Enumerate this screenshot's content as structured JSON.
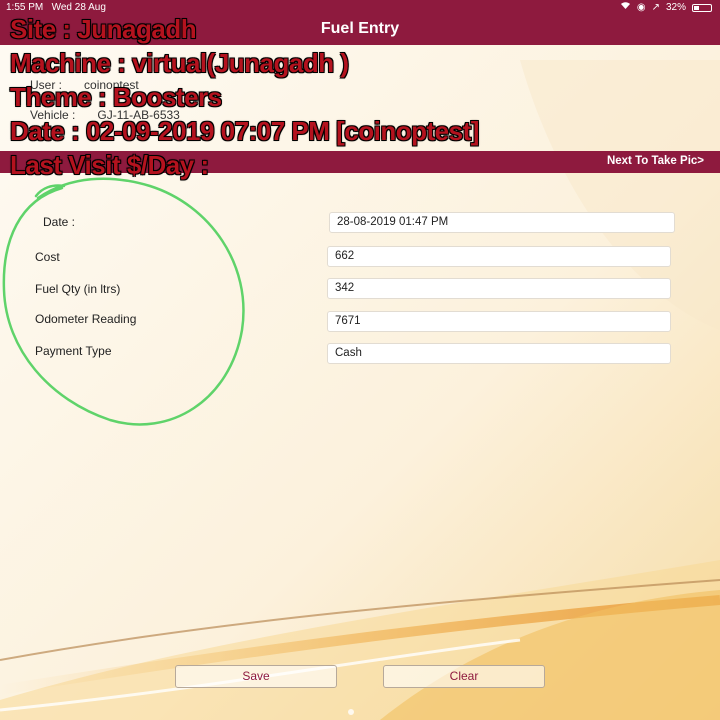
{
  "status_bar": {
    "time": "1:55 PM",
    "date": "Wed 28 Aug",
    "battery": "32%",
    "battery_level": 0.32,
    "icons": [
      "wifi-icon",
      "location-icon",
      "bluetooth-icon"
    ]
  },
  "app": {
    "title": "Fuel Entry",
    "header_color": "#8e1a3e"
  },
  "background_info": {
    "user_label": "User :",
    "user_value": "coinoptest",
    "vehicle_label": "Vehicle :",
    "vehicle_value": "GJ-11-AB-6533"
  },
  "overlay": {
    "site": "Site : Junagadh",
    "machine": "Machine : virtual(Junagadh )",
    "theme": "Theme : Boosters",
    "date": "Date : 02-09-2019 07:07 PM [coinoptest]",
    "last_visit": "Last Visit $/Day :"
  },
  "nav": {
    "next_label": "Next To Take Pic>"
  },
  "form": {
    "date_label": "Date :",
    "date_value": "28-08-2019 01:47 PM",
    "cost_label": "Cost",
    "cost_value": "662",
    "fuel_qty_label": "Fuel Qty (in ltrs)",
    "fuel_qty_value": "342",
    "odometer_label": "Odometer Reading",
    "odometer_value": "7671",
    "payment_label": "Payment Type",
    "payment_value": "Cash"
  },
  "buttons": {
    "save": "Save",
    "clear": "Clear"
  }
}
